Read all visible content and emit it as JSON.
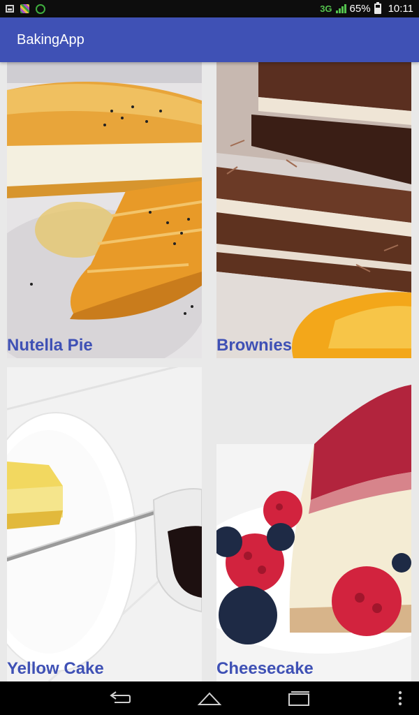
{
  "status_bar": {
    "network": "3G",
    "battery": "65%",
    "time": "10:11",
    "icons": [
      "message-icon",
      "image-notification-icon",
      "app-notification-icon",
      "signal-icon",
      "battery-icon"
    ]
  },
  "app_bar": {
    "title": "BakingApp",
    "color": "#3f51b5"
  },
  "recipes": [
    {
      "name": "Nutella Pie",
      "image": "phyllo-pie-photo"
    },
    {
      "name": "Brownies",
      "image": "layered-chocolate-cake-photo"
    },
    {
      "name": "Yellow Cake",
      "image": "cake-slice-on-plate-photo"
    },
    {
      "name": "Cheesecake",
      "image": "raspberry-cheesecake-photo"
    }
  ],
  "nav_bar": {
    "icons": [
      "back-icon",
      "home-icon",
      "recent-apps-icon",
      "overflow-menu-icon"
    ]
  },
  "colors": {
    "accent": "#3f51b5",
    "status_bar": "#0d0d0d",
    "network": "#54c24e",
    "grid_background": "#e9e9e9"
  }
}
